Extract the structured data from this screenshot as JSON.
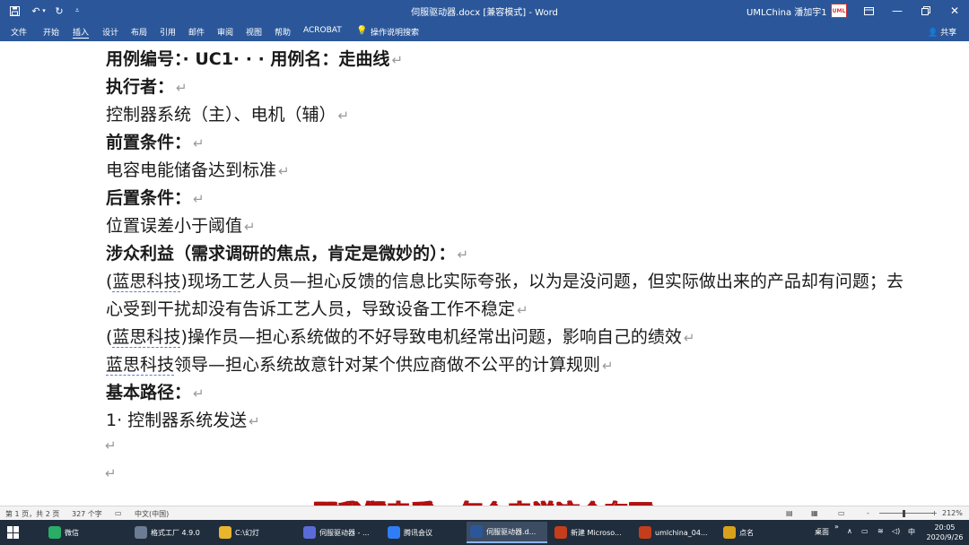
{
  "titlebar": {
    "title": "伺服驱动器.docx [兼容模式]  -  Word",
    "user": "UMLChina 潘加宇1",
    "avatar_text": "UML",
    "icons": [
      "save-icon",
      "undo-icon",
      "redo-icon",
      "customize-icon"
    ]
  },
  "ribbon": {
    "tabs": [
      "文件",
      "开始",
      "插入",
      "设计",
      "布局",
      "引用",
      "邮件",
      "审阅",
      "视图",
      "帮助",
      "ACROBAT",
      "操作说明搜索"
    ],
    "active_tab": "插入",
    "share": "共享"
  },
  "document": {
    "lines": [
      {
        "text": "用例编号：· UC1· · · 用例名：走曲线",
        "bold": true
      },
      {
        "text": "执行者：",
        "bold": true
      },
      {
        "text": "控制器系统（主）、电机（辅）",
        "bold": false
      },
      {
        "text": "前置条件：",
        "bold": true
      },
      {
        "text": "电容电能储备达到标准",
        "bold": false
      },
      {
        "text": "后置条件：",
        "bold": true
      },
      {
        "text": "位置误差小于阈值",
        "bold": false
      },
      {
        "text": "涉众利益（需求调研的焦点，肯定是微妙的）：",
        "bold": true
      },
      {
        "text_pre": "(",
        "text_u": "蓝思科技",
        "text_post": ")现场工艺人员—担心反馈的信息比实际夸张，以为是没问题，但实际做出来的产品却有问题；去",
        "bold": false,
        "no_mark": true
      },
      {
        "text": "心受到干扰却没有告诉工艺人员，导致设备工作不稳定",
        "bold": false
      },
      {
        "text_pre": "(",
        "text_u": "蓝思科技",
        "text_post": ")操作员—担心系统做的不好导致电机经常出问题，影响自己的绩效",
        "bold": false
      },
      {
        "text_pre": "",
        "text_u": "蓝思科技",
        "text_post": "领导—担心系统故意针对某个供应商做不公平的计算规则",
        "bold": false
      },
      {
        "text": "基本路径：",
        "bold": true
      },
      {
        "text": "1· 控制器系统发送",
        "bold": false
      }
    ],
    "paragraph_mark": "↵"
  },
  "subtitle": "那我们来看，怎么来说这个东西",
  "statusbar": {
    "page": "第 1 页，共 2 页",
    "words": "327 个字",
    "language": "中文(中国)",
    "zoom": "212%",
    "zoom_minus": "-",
    "zoom_plus": "+"
  },
  "taskbar": {
    "items": [
      {
        "label": "微信",
        "color": "#2aae67",
        "icon": "wechat-icon"
      },
      {
        "label": "格式工厂 4.9.0",
        "color": "#6b7c93",
        "icon": "format-factory-icon"
      },
      {
        "label": "C:\\幻灯",
        "color": "#e8b62c",
        "icon": "folder-icon"
      },
      {
        "label": "伺服驱动器 - ...",
        "color": "#5a6bd8",
        "icon": "app-icon"
      },
      {
        "label": "腾讯会议",
        "color": "#2f7ef5",
        "icon": "tencent-meeting-icon"
      },
      {
        "label": "伺服驱动器.d...",
        "color": "#2b579a",
        "icon": "word-icon"
      },
      {
        "label": "新建 Microso...",
        "color": "#c43e1c",
        "icon": "powerpoint-icon"
      },
      {
        "label": "umlchina_04...",
        "color": "#c43e1c",
        "icon": "powerpoint-icon"
      },
      {
        "label": "点名",
        "color": "#d9a11b",
        "icon": "app-icon"
      }
    ],
    "tray": {
      "desktop": "桌面",
      "ime": "中"
    },
    "time": "20:05",
    "date": "2020/9/26"
  }
}
